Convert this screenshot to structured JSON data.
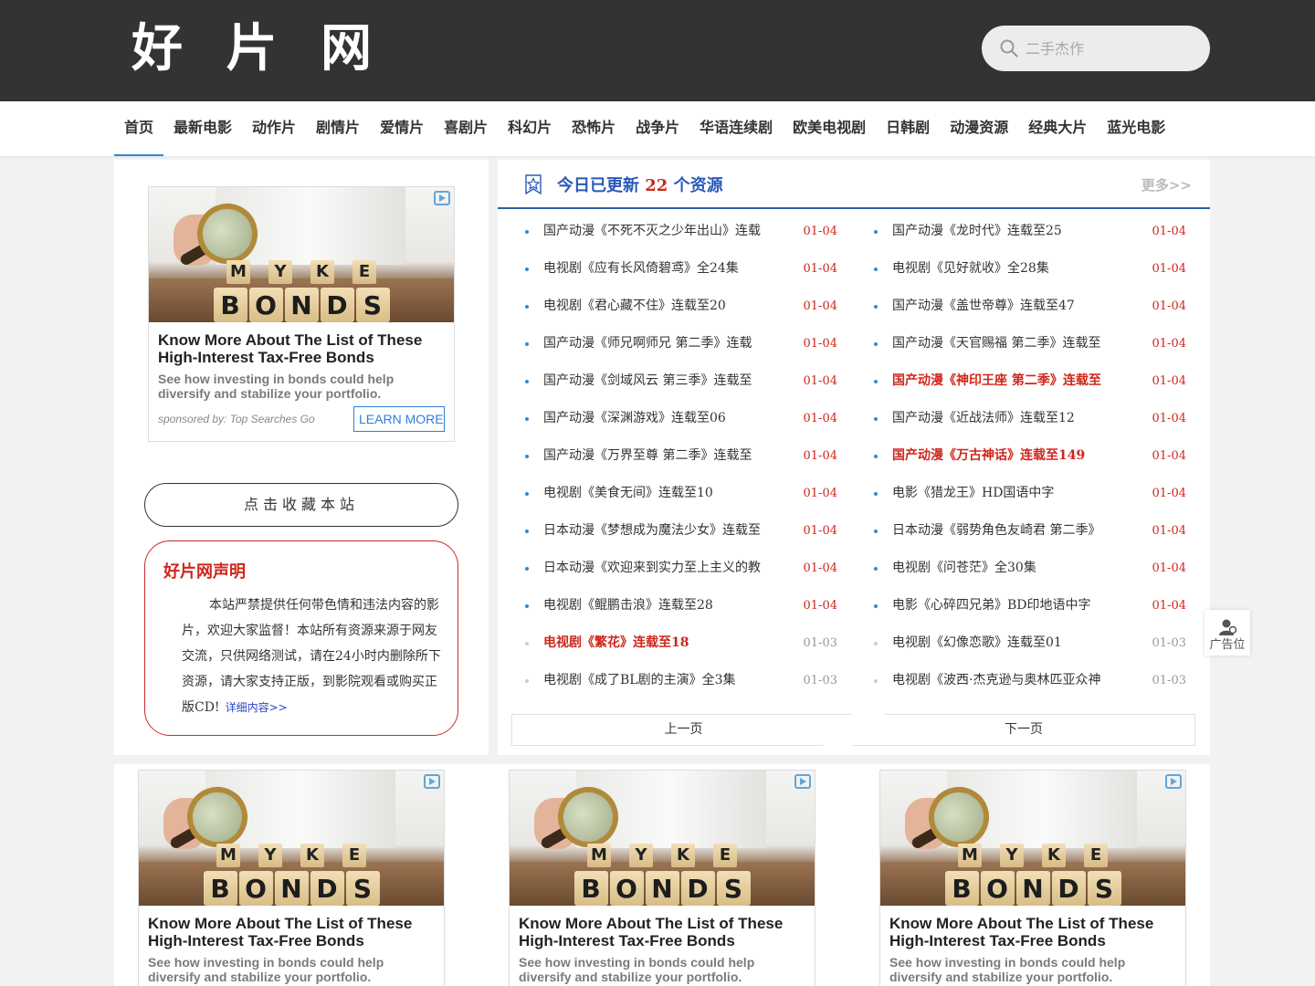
{
  "site": {
    "logo": "好 片 网"
  },
  "search": {
    "placeholder": "二手杰作"
  },
  "nav": [
    "首页",
    "最新电影",
    "动作片",
    "剧情片",
    "爱情片",
    "喜剧片",
    "科幻片",
    "恐怖片",
    "战争片",
    "华语连续剧",
    "欧美电视剧",
    "日韩剧",
    "动漫资源",
    "经典大片",
    "蓝光电影"
  ],
  "ad": {
    "title": "Know More About The List of These High-Interest Tax-Free Bonds",
    "desc": "See how investing in bonds could help diversify and stabilize your portfolio.",
    "sponsor": "sponsored by: Top Searches Go",
    "cta": "LEARN MORE",
    "image_word": "BONDS",
    "image_upper": [
      "M",
      "Y",
      "K",
      "E"
    ]
  },
  "sidebar": {
    "fav_label": "点击收藏本站",
    "notice_title": "好片网声明",
    "notice_text": "本站严禁提供任何带色情和违法内容的影片，欢迎大家监督！本站所有资源来源于网友交流，只供网络测试，请在24小时内删除所下资源，请大家支持正版，到影院观看或购买正版CD!",
    "notice_link": "详细内容>>"
  },
  "updates": {
    "title_prefix": "今日已更新",
    "count": "22",
    "title_suffix": "个资源",
    "more": "更多>>",
    "col1": [
      {
        "title": "国产动漫《不死不灭之少年出山》连载",
        "date": "01-04",
        "hot": false,
        "old": false
      },
      {
        "title": "电视剧《应有长风倚碧鸢》全24集",
        "date": "01-04",
        "hot": false,
        "old": false
      },
      {
        "title": "电视剧《君心藏不住》连载至20",
        "date": "01-04",
        "hot": false,
        "old": false
      },
      {
        "title": "国产动漫《师兄啊师兄 第二季》连载",
        "date": "01-04",
        "hot": false,
        "old": false
      },
      {
        "title": "国产动漫《剑域风云 第三季》连载至",
        "date": "01-04",
        "hot": false,
        "old": false
      },
      {
        "title": "国产动漫《深渊游戏》连载至06",
        "date": "01-04",
        "hot": false,
        "old": false
      },
      {
        "title": "国产动漫《万界至尊 第二季》连载至",
        "date": "01-04",
        "hot": false,
        "old": false
      },
      {
        "title": "电视剧《美食无间》连载至10",
        "date": "01-04",
        "hot": false,
        "old": false
      },
      {
        "title": "日本动漫《梦想成为魔法少女》连载至",
        "date": "01-04",
        "hot": false,
        "old": false
      },
      {
        "title": "日本动漫《欢迎来到实力至上主义的教",
        "date": "01-04",
        "hot": false,
        "old": false
      },
      {
        "title": "电视剧《鲲鹏击浪》连载至28",
        "date": "01-04",
        "hot": false,
        "old": false
      },
      {
        "title": "电视剧《繁花》连载至18",
        "date": "01-03",
        "hot": true,
        "old": true
      },
      {
        "title": "电视剧《成了BL剧的主演》全3集",
        "date": "01-03",
        "hot": false,
        "old": true
      }
    ],
    "col2": [
      {
        "title": "国产动漫《龙时代》连载至25",
        "date": "01-04",
        "hot": false,
        "old": false
      },
      {
        "title": "电视剧《见好就收》全28集",
        "date": "01-04",
        "hot": false,
        "old": false
      },
      {
        "title": "国产动漫《盖世帝尊》连载至47",
        "date": "01-04",
        "hot": false,
        "old": false
      },
      {
        "title": "国产动漫《天官赐福 第二季》连载至",
        "date": "01-04",
        "hot": false,
        "old": false
      },
      {
        "title": "国产动漫《神印王座 第二季》连载至",
        "date": "01-04",
        "hot": true,
        "old": false
      },
      {
        "title": "国产动漫《近战法师》连载至12",
        "date": "01-04",
        "hot": false,
        "old": false
      },
      {
        "title": "国产动漫《万古神话》连载至149",
        "date": "01-04",
        "hot": true,
        "old": false
      },
      {
        "title": "电影《猎龙王》HD国语中字",
        "date": "01-04",
        "hot": false,
        "old": false
      },
      {
        "title": "日本动漫《弱势角色友崎君 第二季》",
        "date": "01-04",
        "hot": false,
        "old": false
      },
      {
        "title": "电视剧《问苍茫》全30集",
        "date": "01-04",
        "hot": false,
        "old": false
      },
      {
        "title": "电影《心碎四兄弟》BD印地语中字",
        "date": "01-04",
        "hot": false,
        "old": false
      },
      {
        "title": "电视剧《幻像恋歌》连载至01",
        "date": "01-03",
        "hot": false,
        "old": true
      },
      {
        "title": "电视剧《波西·杰克逊与奥林匹亚众神",
        "date": "01-03",
        "hot": false,
        "old": true
      }
    ],
    "prev": "上一页",
    "next": "下一页"
  },
  "side_ad": {
    "label": "广告位"
  },
  "colors": {
    "header_bg": "#333333",
    "accent_blue": "#2a59b8",
    "accent_red": "#d0261b"
  }
}
